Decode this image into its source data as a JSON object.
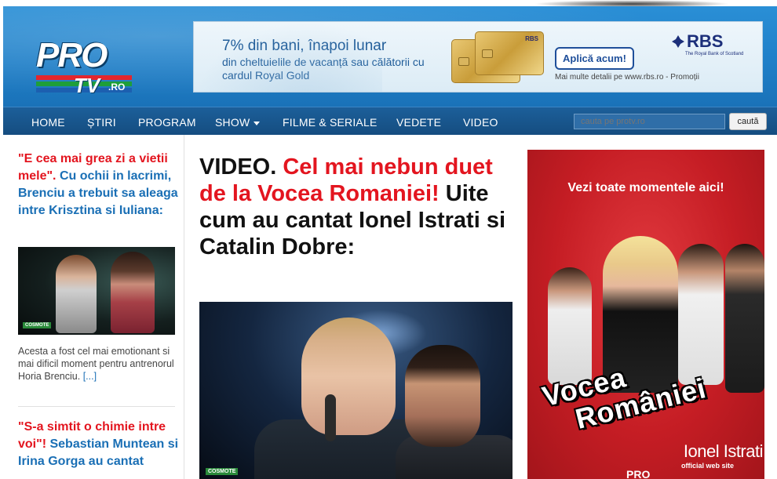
{
  "header": {
    "logo": {
      "pro": "PRO",
      "tv": "TV",
      "domain": ".RO"
    }
  },
  "banner": {
    "headline": "7% din bani, înapoi lunar",
    "subtext": "din cheltuielile de vacanță sau călătorii cu cardul Royal Gold",
    "cta": "Aplică acum!",
    "brand": "RBS",
    "brand_tagline": "The Royal Bank of Scotland",
    "more_info": "Mai multe detalii pe www.rbs.ro - Promoții",
    "card_brand": "RBS"
  },
  "nav": {
    "items": [
      {
        "label": "HOME"
      },
      {
        "label": "ȘTIRI"
      },
      {
        "label": "PROGRAM"
      },
      {
        "label": "SHOW"
      },
      {
        "label": "FILME & SERIALE"
      },
      {
        "label": "VEDETE"
      },
      {
        "label": "VIDEO"
      }
    ],
    "search_placeholder": "cauta pe protv.ro",
    "search_button": "caută"
  },
  "left_column": {
    "story1": {
      "title_red": "\"E cea mai grea zi a vietii mele\".",
      "title_blue": " Cu ochii in lacrimi, Brenciu a trebuit sa aleaga intre Krisztina si Iuliana:",
      "thumb_bug": "COSMOTE",
      "description": "Acesta a fost cel mai emotionant si mai dificil moment pentru antrenorul Horia Brenciu. ",
      "more_link": "[...]"
    },
    "story2": {
      "title_red": "\"S-a simtit o chimie intre voi\"!",
      "title_blue": " Sebastian Muntean si Irina Gorga au cantat"
    }
  },
  "article": {
    "title_prefix": "VIDEO. ",
    "title_red": "Cel mai nebun duet de la Vocea Romaniei!",
    "title_rest": " Uite cum au cantat Ionel Istrati si Catalin Dobre:",
    "video_bug": "COSMOTE"
  },
  "right_ad": {
    "cta": "Vezi toate momentele aici!",
    "logo_line1": "Vocea",
    "logo_line2": "României",
    "name": "Ionel Istrati",
    "site": "official web site",
    "channel": "PRO"
  },
  "colors": {
    "header_blue": "#1f7fc8",
    "nav_blue": "#154d80",
    "headline_red": "#e3151f",
    "link_blue": "#1a6fb5",
    "ad_red": "#c51d24"
  }
}
